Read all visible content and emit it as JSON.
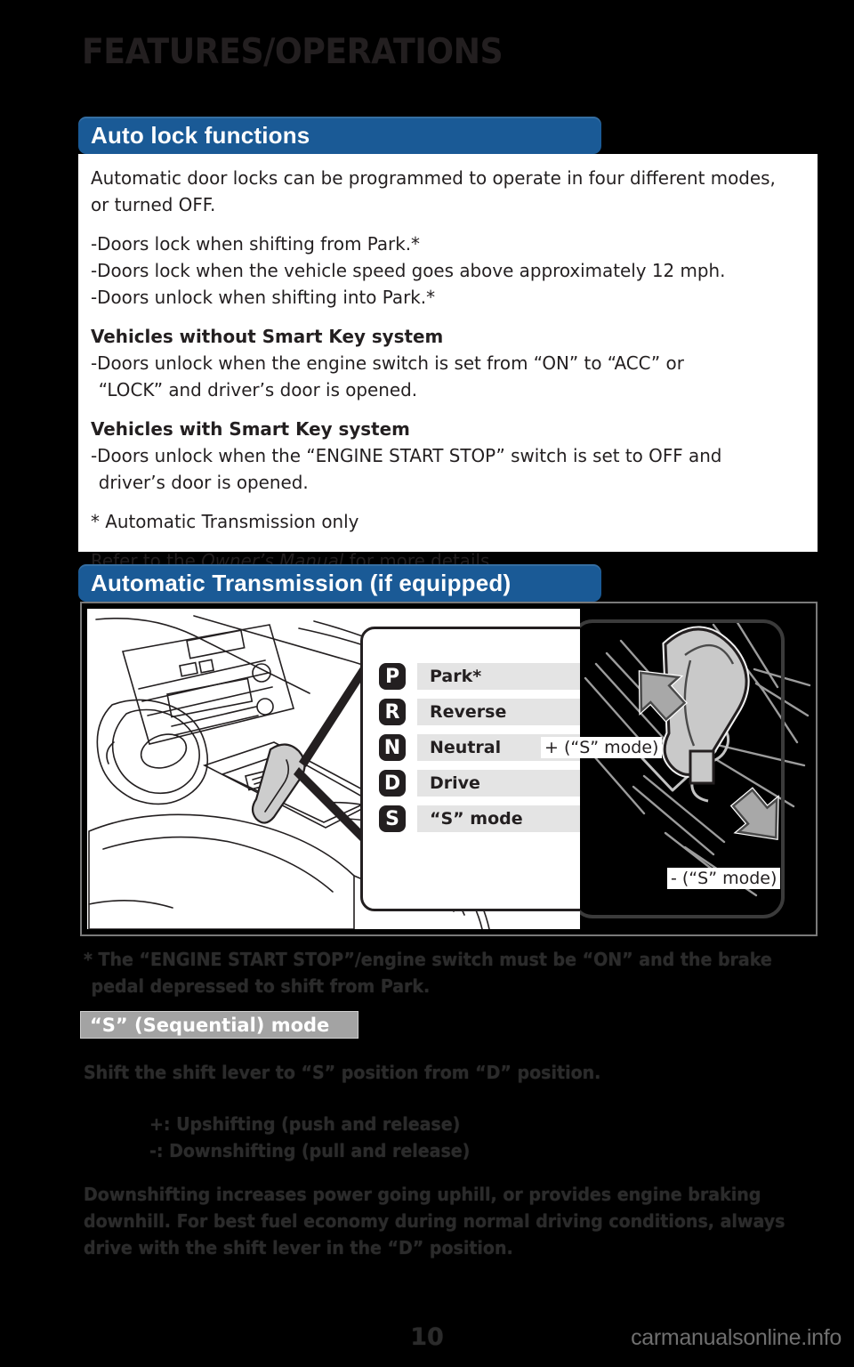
{
  "page": {
    "title": "FEATURES/OPERATIONS",
    "number": "10",
    "watermark": "carmanualsonline.info"
  },
  "sections": {
    "auto_lock": {
      "header": "Auto lock functions",
      "intro": "Automatic door locks can be programmed to operate in four different modes, or turned OFF.",
      "bullets": [
        "-Doors lock when shifting from Park.*",
        "-Doors lock when the vehicle speed goes above approximately 12 mph.",
        "-Doors unlock when shifting into Park.*"
      ],
      "without_smart_key": {
        "heading": "Vehicles without Smart Key system",
        "line1": "-Doors unlock when the engine switch is set from “ON” to “ACC” or",
        "line2": "“LOCK” and driver’s door is opened."
      },
      "with_smart_key": {
        "heading": "Vehicles with Smart Key system",
        "line1": "-Doors unlock when the “ENGINE START STOP” switch is set to OFF and",
        "line2": "driver’s door is opened."
      },
      "footnote": "* Automatic Transmission only",
      "refer_prefix": "Refer to the ",
      "refer_italic": "Owner’s Manual",
      "refer_suffix": " for more details."
    },
    "transmission": {
      "header": "Automatic Transmission (if equipped)",
      "gears": [
        {
          "badge": "P",
          "label": "Park*"
        },
        {
          "badge": "R",
          "label": "Reverse"
        },
        {
          "badge": "N",
          "label": "Neutral"
        },
        {
          "badge": "D",
          "label": "Drive"
        },
        {
          "badge": "S",
          "label": "“S” mode"
        }
      ],
      "plus_label": "+ (“S” mode)",
      "minus_label": "- (“S” mode)",
      "footnote_line1": "* The “ENGINE START STOP”/engine switch must be “ON” and the brake",
      "footnote_line2": "pedal depressed to shift from Park.",
      "sequential_badge": "“S” (Sequential) mode",
      "sequential_instruction": "Shift the shift lever to “S” position from “D” position.",
      "bullet_up": "+:  Upshifting (push and release)",
      "bullet_down": "-:  Downshifting (pull and release)",
      "summary_line1": "Downshifting increases power going uphill, or provides engine braking",
      "summary_line2": "downhill. For best fuel economy during normal driving conditions, always",
      "summary_line3": "drive with the shift lever in the “D” position."
    }
  },
  "colors": {
    "header_blue": "#1a5a96",
    "page_background": "#000000",
    "panel_white": "#ffffff",
    "badge_grey": "#a3a3a3",
    "text_dark": "#231f20"
  }
}
